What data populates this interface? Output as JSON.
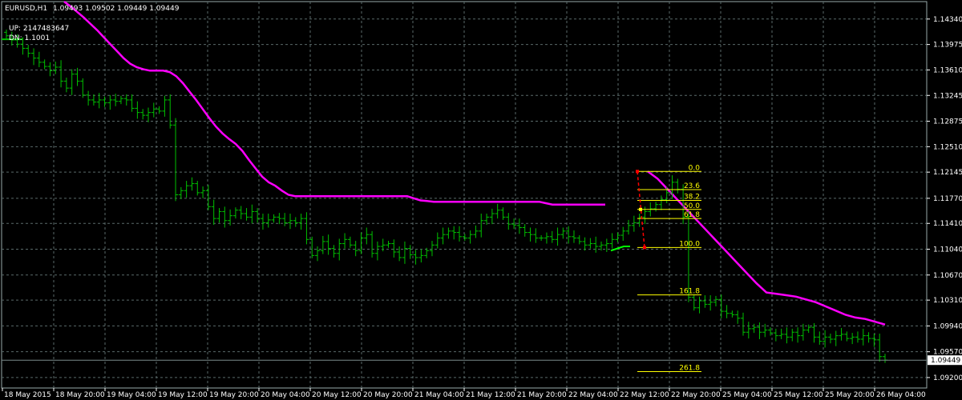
{
  "header": {
    "symbol": "EURUSD,H1",
    "ohlc": "1.09493 1.09502 1.09449 1.09449",
    "up_label": "UP: 2147483647",
    "dn_label": "DN: 1.1001"
  },
  "chart_data": {
    "type": "candlestick-bars",
    "symbol": "EURUSD",
    "timeframe": "H1",
    "ylim": [
      1.0905,
      1.1459
    ],
    "grid": true,
    "colors": {
      "background": "#000000",
      "bars": "#00c000",
      "ma": "#ff00ff",
      "fibonacci": "#ffff00",
      "fib_trend": "#ff0000",
      "grid": "#5a6a6a"
    },
    "y_ticks": [
      "1.14340",
      "1.13975",
      "1.13610",
      "1.13245",
      "1.12875",
      "1.12510",
      "1.12145",
      "1.11770",
      "1.11410",
      "1.11040",
      "1.10670",
      "1.10310",
      "1.09940",
      "1.09570",
      "1.09200"
    ],
    "current_price": "1.09449",
    "x_ticks": [
      "18 May 2015",
      "18 May 20:00",
      "19 May 04:00",
      "19 May 12:00",
      "19 May 20:00",
      "20 May 04:00",
      "20 May 12:00",
      "20 May 20:00",
      "21 May 04:00",
      "21 May 12:00",
      "21 May 20:00",
      "22 May 04:00",
      "22 May 12:00",
      "22 May 20:00",
      "25 May 04:00",
      "25 May 12:00",
      "25 May 20:00",
      "26 May 04:00"
    ],
    "bars_close": [
      1.141,
      1.1404,
      1.1398,
      1.1392,
      1.1385,
      1.1378,
      1.1372,
      1.1366,
      1.136,
      1.1365,
      1.1345,
      1.1335,
      1.1355,
      1.1345,
      1.1325,
      1.1318,
      1.1315,
      1.1318,
      1.1314,
      1.1318,
      1.1316,
      1.132,
      1.1318,
      1.1306,
      1.13,
      1.1296,
      1.13,
      1.1305,
      1.1302,
      1.1318,
      1.1282,
      1.1182,
      1.1188,
      1.1195,
      1.1198,
      1.1185,
      1.1188,
      1.1165,
      1.1148,
      1.1158,
      1.1145,
      1.1152,
      1.116,
      1.1155,
      1.115,
      1.1158,
      1.1148,
      1.1142,
      1.1146,
      1.115,
      1.1148,
      1.1142,
      1.1145,
      1.1142,
      1.1148,
      1.1118,
      1.1095,
      1.1102,
      1.1115,
      1.1105,
      1.1098,
      1.1112,
      1.1118,
      1.111,
      1.1102,
      1.112,
      1.1125,
      1.1098,
      1.1108,
      1.111,
      1.1112,
      1.11,
      1.1092,
      1.1105,
      1.1096,
      1.1092,
      1.1095,
      1.1102,
      1.111,
      1.112,
      1.1125,
      1.113,
      1.1128,
      1.1122,
      1.112,
      1.1125,
      1.113,
      1.1145,
      1.115,
      1.1155,
      1.116,
      1.115,
      1.114,
      1.1138,
      1.1135,
      1.1128,
      1.1125,
      1.112,
      1.112,
      1.1122,
      1.1118,
      1.1125,
      1.113,
      1.1122,
      1.112,
      1.1115,
      1.111,
      1.1112,
      1.1108,
      1.111,
      1.1112,
      1.1118,
      1.1124,
      1.113,
      1.1138,
      1.1142,
      1.115,
      1.1158,
      1.1162,
      1.1168,
      1.1175,
      1.1185,
      1.12,
      1.119,
      1.115,
      1.1035,
      1.102,
      1.103,
      1.1025,
      1.1028,
      1.1032,
      1.1015,
      1.1012,
      1.101,
      1.1005,
      1.0985,
      1.099,
      1.0992,
      1.0985,
      1.0988,
      1.0984,
      1.098,
      1.0982,
      1.0978,
      1.0985,
      1.098,
      1.0988,
      1.0992,
      1.0978,
      1.0972,
      1.0978,
      1.0975,
      1.098,
      1.0982,
      1.0976,
      1.0978,
      1.0975,
      1.098,
      1.0976,
      1.0974,
      1.095,
      1.0945
    ]
  },
  "ma_label": "",
  "fibonacci": {
    "levels": [
      {
        "label": "0.0",
        "price": 1.12155
      },
      {
        "label": "23.6",
        "price": 1.11895
      },
      {
        "label": "38.2",
        "price": 1.1174
      },
      {
        "label": "50.0",
        "price": 1.1161
      },
      {
        "label": "61.8",
        "price": 1.1148
      },
      {
        "label": "100.0",
        "price": 1.11065
      },
      {
        "label": "161.8",
        "price": 1.10385
      },
      {
        "label": "261.8",
        "price": 1.09285
      }
    ]
  },
  "ma_series": [
    1.1459,
    1.1452,
    1.1444,
    1.1436,
    1.1427,
    1.1418,
    1.1408,
    1.1398,
    1.1388,
    1.1378,
    1.137,
    1.1365,
    1.1362,
    1.136,
    1.136,
    1.136,
    1.1358,
    1.1352,
    1.1342,
    1.133,
    1.1318,
    1.1305,
    1.1292,
    1.128,
    1.127,
    1.1262,
    1.1255,
    1.1245,
    1.1232,
    1.122,
    1.1208,
    1.12,
    1.1195,
    1.1188,
    1.1182,
    1.118,
    1.118,
    1.118,
    1.118,
    1.118,
    1.118,
    1.118,
    1.118,
    1.118,
    1.118,
    1.118,
    1.118,
    1.118,
    1.118,
    1.118,
    1.118,
    1.118,
    1.118,
    1.1177,
    1.1174,
    1.1173,
    1.1172,
    1.1172,
    1.1172,
    1.1172,
    1.1172,
    1.1172,
    1.1172,
    1.1172,
    1.1172,
    1.1172,
    1.1172,
    1.1172,
    1.1172,
    1.1172,
    1.1172,
    1.1172,
    1.1172,
    1.117,
    1.1168,
    1.1168,
    1.1168,
    1.1168,
    1.1168,
    1.1168,
    1.1168,
    1.1168,
    1.1168
  ]
}
